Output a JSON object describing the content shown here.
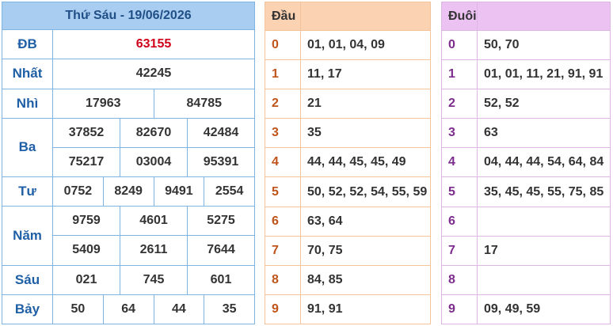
{
  "header": {
    "title": "Thứ Sáu - 19/06/2026"
  },
  "prizes": [
    {
      "label": "ĐB",
      "values": [
        "63155"
      ]
    },
    {
      "label": "Nhất",
      "values": [
        "42245"
      ]
    },
    {
      "label": "Nhì",
      "values": [
        "17963",
        "84785"
      ]
    },
    {
      "label": "Ba",
      "values": [
        "37852",
        "82670",
        "42484",
        "75217",
        "03004",
        "95391"
      ]
    },
    {
      "label": "Tư",
      "values": [
        "0752",
        "8249",
        "9491",
        "2554"
      ]
    },
    {
      "label": "Năm",
      "values": [
        "9759",
        "4601",
        "5275",
        "5409",
        "2611",
        "7644"
      ]
    },
    {
      "label": "Sáu",
      "values": [
        "021",
        "745",
        "601"
      ]
    },
    {
      "label": "Bảy",
      "values": [
        "50",
        "64",
        "44",
        "35"
      ]
    }
  ],
  "dau": {
    "title": "Đầu",
    "rows": [
      {
        "key": "0",
        "values": "01, 01, 04, 09"
      },
      {
        "key": "1",
        "values": "11, 17"
      },
      {
        "key": "2",
        "values": "21"
      },
      {
        "key": "3",
        "values": "35"
      },
      {
        "key": "4",
        "values": "44, 44, 45, 45, 49"
      },
      {
        "key": "5",
        "values": "50, 52, 52, 54, 55, 59"
      },
      {
        "key": "6",
        "values": "63, 64"
      },
      {
        "key": "7",
        "values": "70, 75"
      },
      {
        "key": "8",
        "values": "84, 85"
      },
      {
        "key": "9",
        "values": "91, 91"
      }
    ]
  },
  "duoi": {
    "title": "Đuôi",
    "rows": [
      {
        "key": "0",
        "values": "50, 70"
      },
      {
        "key": "1",
        "values": "01, 01, 11, 21, 91, 91"
      },
      {
        "key": "2",
        "values": "52, 52"
      },
      {
        "key": "3",
        "values": "63"
      },
      {
        "key": "4",
        "values": "04, 44, 44, 54, 64, 84"
      },
      {
        "key": "5",
        "values": "35, 45, 45, 55, 75, 85"
      },
      {
        "key": "6",
        "values": ""
      },
      {
        "key": "7",
        "values": "17"
      },
      {
        "key": "8",
        "values": ""
      },
      {
        "key": "9",
        "values": "09, 49, 59"
      }
    ]
  },
  "colors": {
    "special_prize": "#d0021b",
    "results_header": "#a9cdf0",
    "dau_header": "#fbd3b2",
    "duoi_header": "#ecc2f2"
  }
}
